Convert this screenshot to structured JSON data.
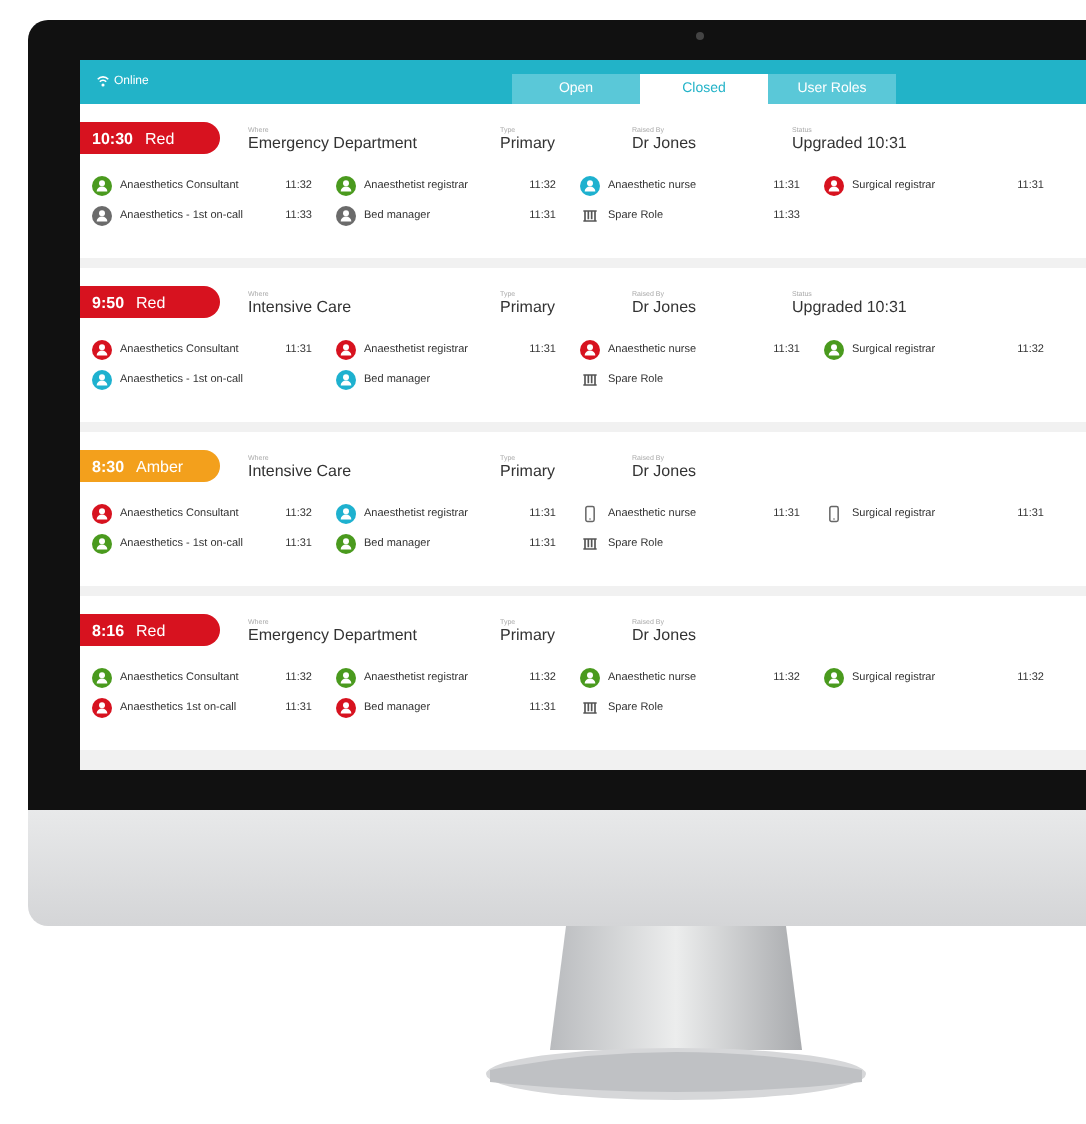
{
  "header": {
    "status": "Online",
    "tabs": [
      {
        "label": "Open",
        "selected": false
      },
      {
        "label": "Closed",
        "selected": true
      },
      {
        "label": "User Roles",
        "selected": false
      }
    ]
  },
  "incidents": [
    {
      "time": "10:30",
      "level": "Red",
      "color": "#d7121f",
      "where_label": "Where",
      "where": "Emergency Department",
      "type_label": "Type",
      "type": "Primary",
      "raised_label": "Raised By",
      "raised_by": "Dr Jones",
      "status_label": "Status",
      "status": "Upgraded 10:31",
      "roles": [
        {
          "kind": "person",
          "color": "#4a9a1e",
          "name": "Anaesthetics Consultant",
          "time": "11:32"
        },
        {
          "kind": "person",
          "color": "#4a9a1e",
          "name": "Anaesthetist registrar",
          "time": "11:32"
        },
        {
          "kind": "person",
          "color": "#1eb1cf",
          "name": "Anaesthetic nurse",
          "time": "11:31"
        },
        {
          "kind": "person",
          "color": "#d7121f",
          "name": "Surgical registrar",
          "time": "11:31"
        },
        {
          "kind": "person",
          "color": "#6b6b6b",
          "name": "Anaesthetics - 1st on-call",
          "time": "11:33"
        },
        {
          "kind": "person",
          "color": "#6b6b6b",
          "name": "Bed manager",
          "time": "11:31"
        },
        {
          "kind": "spare",
          "name": "Spare Role",
          "time": "11:33"
        }
      ]
    },
    {
      "time": "9:50",
      "level": "Red",
      "color": "#d7121f",
      "where_label": "Where",
      "where": "Intensive Care",
      "type_label": "Type",
      "type": "Primary",
      "raised_label": "Raised By",
      "raised_by": "Dr Jones",
      "status_label": "Status",
      "status": "Upgraded 10:31",
      "roles": [
        {
          "kind": "person",
          "color": "#d7121f",
          "name": "Anaesthetics Consultant",
          "time": "11:31"
        },
        {
          "kind": "person",
          "color": "#d7121f",
          "name": "Anaesthetist registrar",
          "time": "11:31"
        },
        {
          "kind": "person",
          "color": "#d7121f",
          "name": "Anaesthetic nurse",
          "time": "11:31"
        },
        {
          "kind": "person",
          "color": "#4a9a1e",
          "name": "Surgical registrar",
          "time": "11:32"
        },
        {
          "kind": "person",
          "color": "#1eb1cf",
          "name": "Anaesthetics - 1st on-call"
        },
        {
          "kind": "person",
          "color": "#1eb1cf",
          "name": "Bed manager"
        },
        {
          "kind": "spare",
          "name": "Spare Role"
        }
      ]
    },
    {
      "time": "8:30",
      "level": "Amber",
      "color": "#f3a01c",
      "where_label": "Where",
      "where": "Intensive Care",
      "type_label": "Type",
      "type": "Primary",
      "raised_label": "Raised By",
      "raised_by": "Dr Jones",
      "roles": [
        {
          "kind": "person",
          "color": "#d7121f",
          "name": "Anaesthetics Consultant",
          "time": "11:32"
        },
        {
          "kind": "person",
          "color": "#1eb1cf",
          "name": "Anaesthetist registrar",
          "time": "11:31"
        },
        {
          "kind": "phone",
          "name": "Anaesthetic nurse",
          "time": "11:31"
        },
        {
          "kind": "phone",
          "name": "Surgical registrar",
          "time": "11:31"
        },
        {
          "kind": "person",
          "color": "#4a9a1e",
          "name": "Anaesthetics - 1st on-call",
          "time": "11:31"
        },
        {
          "kind": "person",
          "color": "#4a9a1e",
          "name": "Bed manager",
          "time": "11:31"
        },
        {
          "kind": "spare",
          "name": "Spare Role"
        }
      ]
    },
    {
      "time": "8:16",
      "level": "Red",
      "color": "#d7121f",
      "where_label": "Where",
      "where": "Emergency Department",
      "type_label": "Type",
      "type": "Primary",
      "raised_label": "Raised By",
      "raised_by": "Dr Jones",
      "roles": [
        {
          "kind": "person",
          "color": "#4a9a1e",
          "name": "Anaesthetics Consultant",
          "time": "11:32"
        },
        {
          "kind": "person",
          "color": "#4a9a1e",
          "name": "Anaesthetist registrar",
          "time": "11:32"
        },
        {
          "kind": "person",
          "color": "#4a9a1e",
          "name": "Anaesthetic nurse",
          "time": "11:32"
        },
        {
          "kind": "person",
          "color": "#4a9a1e",
          "name": "Surgical registrar",
          "time": "11:32"
        },
        {
          "kind": "person",
          "color": "#d7121f",
          "name": "Anaesthetics 1st on-call",
          "time": "11:31"
        },
        {
          "kind": "person",
          "color": "#d7121f",
          "name": "Bed manager",
          "time": "11:31"
        },
        {
          "kind": "spare",
          "name": "Spare Role"
        }
      ]
    }
  ]
}
